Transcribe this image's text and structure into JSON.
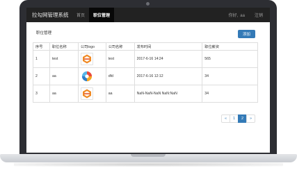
{
  "navbar": {
    "brand": "拉勾网管理系统",
    "items": [
      {
        "label": "首页",
        "active": false
      },
      {
        "label": "职位管理",
        "active": true
      }
    ],
    "greeting_prefix": "你好,",
    "username": "aa",
    "logout_label": "注销"
  },
  "main": {
    "title": "职位管理",
    "add_label": "添加"
  },
  "table": {
    "headers": [
      "序号",
      "职位名称",
      "公司logo",
      "公司名称",
      "发布时间",
      "职位薪资"
    ],
    "rows": [
      {
        "no": "1",
        "position": "test",
        "logo": "lagou-logo-icon",
        "company": "test",
        "time": "2017-6-16 14:24",
        "salary": "565"
      },
      {
        "no": "2",
        "position": "aa",
        "logo": "swirl-logo-icon",
        "company": "dfd",
        "time": "2017-6-16 12:12",
        "salary": "34"
      },
      {
        "no": "3",
        "position": "aa",
        "logo": "lagou-logo-icon",
        "company": "aa",
        "time": "NaN-NaN-NaN NaN:NaN",
        "salary": "34"
      }
    ]
  },
  "pagination": {
    "prev": "«",
    "pages": [
      "1",
      "2"
    ],
    "current_page": "2",
    "next": "»"
  },
  "colors": {
    "navbar_bg": "#222222",
    "accent": "#337ab7",
    "lagou_orange": "#f08a24",
    "lagou_red": "#e4572e"
  }
}
